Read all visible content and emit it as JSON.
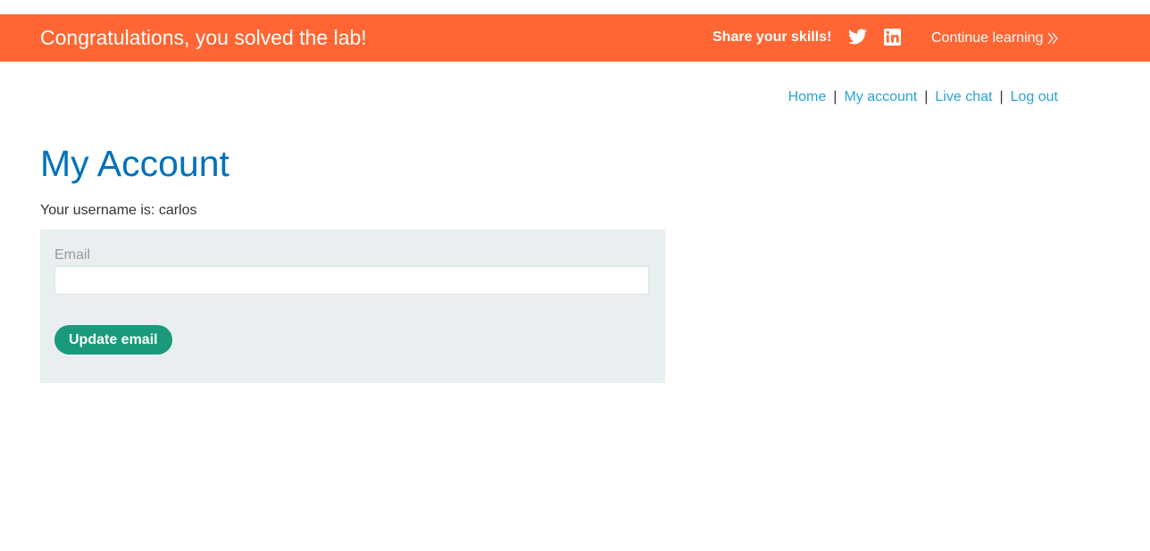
{
  "banner": {
    "title": "Congratulations, you solved the lab!",
    "share_label": "Share your skills!",
    "twitter_icon": "twitter-icon",
    "linkedin_icon": "linkedin-icon",
    "continue_label": "Continue learning",
    "continue_icon": "double-chevron-right-icon",
    "background_color": "#ff6633"
  },
  "nav": {
    "items": [
      {
        "label": "Home"
      },
      {
        "label": "My account"
      },
      {
        "label": "Live chat"
      },
      {
        "label": "Log out"
      }
    ],
    "separator": "|",
    "link_color": "#29a3d9"
  },
  "main": {
    "title": "My Account",
    "username_text": "Your username is: carlos",
    "form": {
      "email_label": "Email",
      "email_value": "",
      "submit_label": "Update email",
      "button_color": "#1a9a7a",
      "panel_color": "#e9eff1"
    }
  }
}
